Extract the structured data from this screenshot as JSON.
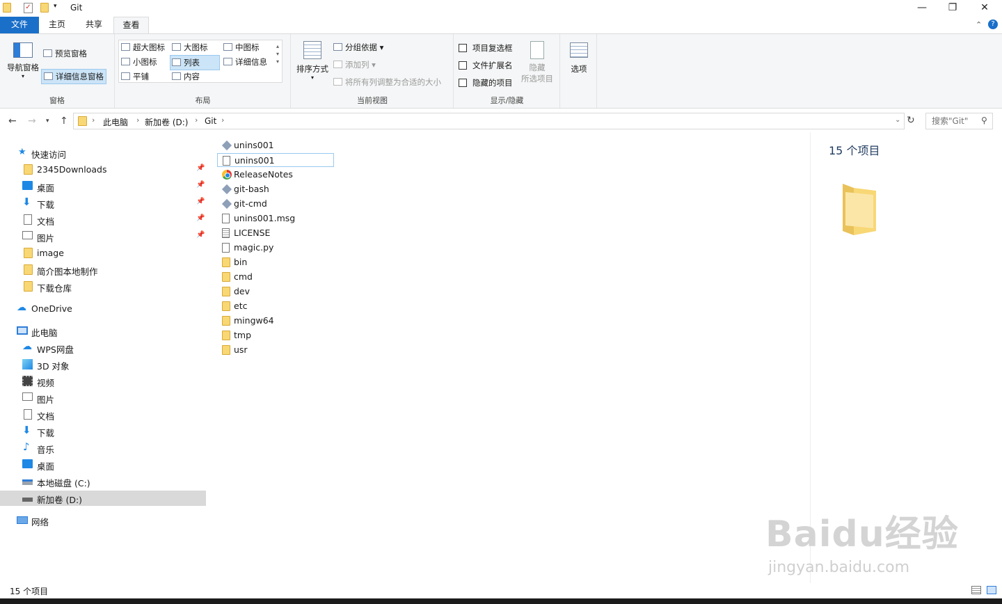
{
  "window": {
    "title": "Git",
    "minimize_icon": "minimize-icon",
    "restore_icon": "restore-icon",
    "close_icon": "close-icon"
  },
  "ribbon_tabs": [
    {
      "label": "文件"
    },
    {
      "label": "主页"
    },
    {
      "label": "共享"
    },
    {
      "label": "查看"
    }
  ],
  "ribbon": {
    "panes": {
      "label": "窗格",
      "nav_pane": "导航窗格",
      "preview_pane": "预览窗格",
      "details_pane": "详细信息窗格"
    },
    "layout": {
      "label": "布局",
      "xl_icons": "超大图标",
      "large_icons": "大图标",
      "medium_icons": "中图标",
      "small_icons": "小图标",
      "list": "列表",
      "details": "详细信息",
      "tiles": "平铺",
      "content": "内容"
    },
    "current_view": {
      "label": "当前视图",
      "sort_by": "排序方式",
      "group_by": "分组依据",
      "add_columns": "添加列",
      "size_columns": "将所有列调整为合适的大小"
    },
    "show_hide": {
      "label": "显示/隐藏",
      "item_checkboxes": "项目复选框",
      "file_extensions": "文件扩展名",
      "hidden_items": "隐藏的项目",
      "hide_selected_1": "隐藏",
      "hide_selected_2": "所选项目"
    },
    "options": {
      "label": "选项"
    }
  },
  "address": {
    "crumbs": [
      "此电脑",
      "新加卷 (D:)",
      "Git"
    ],
    "search_placeholder": "搜索\"Git\""
  },
  "nav": {
    "quick_access": "快速访问",
    "quick_items": [
      "2345Downloads",
      "桌面",
      "下载",
      "文档",
      "图片",
      "image",
      "简介图本地制作",
      "下载仓库"
    ],
    "onedrive": "OneDrive",
    "this_pc": "此电脑",
    "pc_items": [
      "WPS网盘",
      "3D 对象",
      "视频",
      "图片",
      "文档",
      "下载",
      "音乐",
      "桌面",
      "本地磁盘 (C:)",
      "新加卷 (D:)"
    ],
    "network": "网络"
  },
  "files": [
    {
      "name": "unins001",
      "icon": "git-icon"
    },
    {
      "name": "unins001",
      "icon": "file-icon"
    },
    {
      "name": "ReleaseNotes",
      "icon": "chrome-icon"
    },
    {
      "name": "git-bash",
      "icon": "git-icon"
    },
    {
      "name": "git-cmd",
      "icon": "git-icon"
    },
    {
      "name": "unins001.msg",
      "icon": "file-icon"
    },
    {
      "name": "LICENSE",
      "icon": "text-file-icon"
    },
    {
      "name": "magic.py",
      "icon": "file-icon"
    },
    {
      "name": "bin",
      "icon": "folder-icon"
    },
    {
      "name": "cmd",
      "icon": "folder-icon"
    },
    {
      "name": "dev",
      "icon": "folder-icon"
    },
    {
      "name": "etc",
      "icon": "folder-icon"
    },
    {
      "name": "mingw64",
      "icon": "folder-icon"
    },
    {
      "name": "tmp",
      "icon": "folder-icon"
    },
    {
      "name": "usr",
      "icon": "folder-icon"
    }
  ],
  "details_pane": {
    "count": "15 个项目"
  },
  "status": {
    "count": "15 个项目"
  },
  "watermark": {
    "brand": "Baidu经验",
    "url": "jingyan.baidu.com"
  },
  "colors": {
    "file_tab": "#1a6fc9",
    "selection": "#cce4f7",
    "folder": "#f8d775"
  }
}
